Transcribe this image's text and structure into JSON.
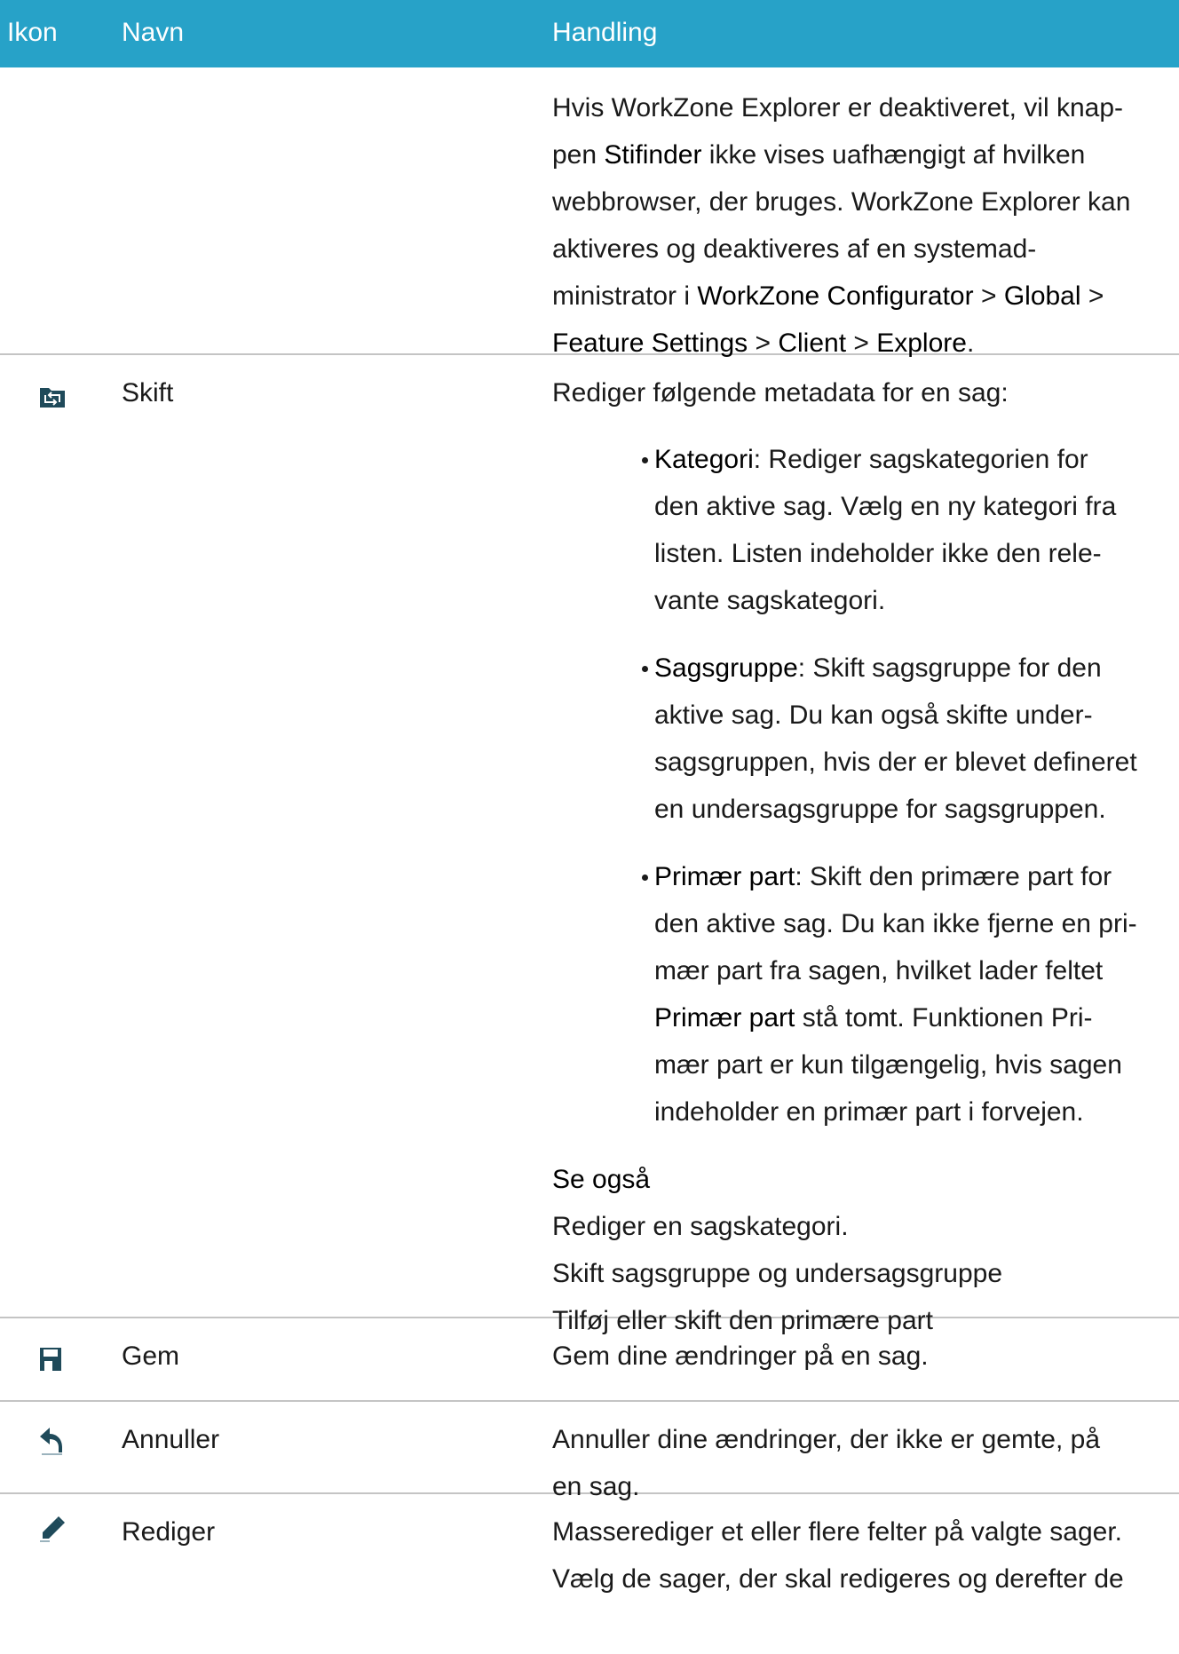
{
  "header": {
    "ikon": "Ikon",
    "navn": "Navn",
    "handling": "Handling"
  },
  "row0": {
    "text": {
      "p1": "Hvis WorkZone Explorer er deaktiveret, vil knap-",
      "p2a": "pen ",
      "p2b": "Stifinder",
      "p2c": " ikke vises uafhængigt af hvilken",
      "p3": "webbrowser, der bruges. WorkZone Explorer kan",
      "p4": "aktiveres og deaktiveres af en systemad-",
      "p5a": "ministrator i ",
      "p5b": "WorkZone Configurator",
      "p5c": " > ",
      "p5d": "Global",
      "p5e": " >",
      "p6a": "Feature Settings",
      "p6b": " > ",
      "p6c": "Client",
      "p6d": " > ",
      "p6e": "Explore",
      "p6f": "."
    }
  },
  "row_skift": {
    "icon": "switch-folder-icon",
    "name": "Skift",
    "intro": "Rediger følgende metadata for en sag:",
    "bullets": [
      {
        "label": "Kategori",
        "lines": [
          ": Rediger sagskategorien for",
          "den aktive sag. Vælg en ny kategori fra",
          "listen. Listen indeholder ikke den rele-",
          "vante sagskategori."
        ]
      },
      {
        "label": "Sagsgruppe",
        "lines": [
          ": Skift sagsgruppe for den",
          "aktive sag. Du kan også skifte under-",
          "sagsgruppen, hvis der er blevet defineret",
          "en undersagsgruppe for sagsgruppen."
        ]
      },
      {
        "label": "Primær part",
        "lines": [
          ": Skift den primære part for",
          "den aktive sag. Du kan ikke fjerne en pri-",
          "mær part fra sagen, hvilket lader feltet"
        ],
        "label2": "Primær part",
        "lines2": [
          " stå tomt. Funktionen Pri-",
          "mær part er kun tilgængelig, hvis sagen",
          "indeholder en primær part i forvejen."
        ]
      }
    ],
    "see_also_title": "Se også",
    "see_also": [
      "Rediger en sagskategori.",
      "Skift sagsgruppe og undersagsgruppe",
      "Tilføj eller skift den primære part"
    ]
  },
  "row_gem": {
    "icon": "save-icon",
    "name": "Gem",
    "text": "Gem dine ændringer på en sag."
  },
  "row_annuller": {
    "icon": "undo-icon",
    "name": "Annuller",
    "line1": "Annuller dine ændringer, der ikke er gemte, på",
    "line2": "en sag."
  },
  "row_rediger": {
    "icon": "edit-pencil-icon",
    "name": "Rediger",
    "line1": "Masserediger et eller flere felter på valgte sager.",
    "line2": "Vælg de sager, der skal redigeres og derefter de"
  },
  "colors": {
    "header_bg": "#27a2c8",
    "icon_dark": "#1f4a5a"
  }
}
